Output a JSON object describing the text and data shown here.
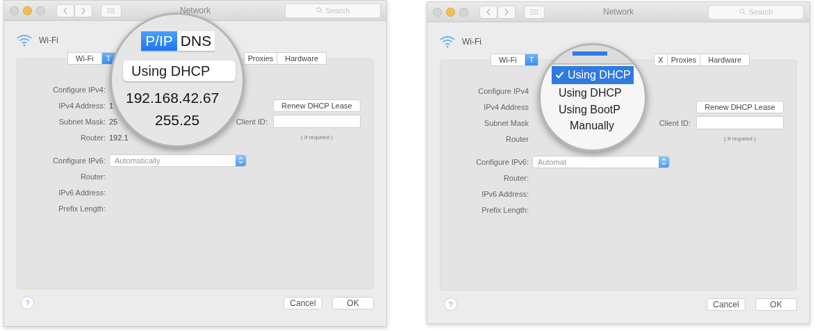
{
  "panels": [
    {
      "window": {
        "title": "Network",
        "search_placeholder": "Search"
      },
      "header": "Wi-Fi",
      "tabs": [
        {
          "label": "Wi-Fi",
          "selected": false
        },
        {
          "label": "T",
          "selected": true
        },
        {
          "label": "Proxies",
          "selected": false
        },
        {
          "label": "Hardware",
          "selected": false
        }
      ],
      "ipv4_rows": [
        {
          "label": "Configure IPv4:"
        },
        {
          "label": "IPv4 Address:",
          "value": "1"
        },
        {
          "label": "Subnet Mask:",
          "value": "25"
        },
        {
          "label": "Router:",
          "value": "192.1"
        }
      ],
      "renew_button": "Renew DHCP Lease",
      "client_id": {
        "label": "Client ID:",
        "hint": "( If required )"
      },
      "ipv6": {
        "label": "Configure IPv6:",
        "value": "Automatically"
      },
      "ipv6_rows": [
        "Router:",
        "IPv6 Address:",
        "Prefix Length:"
      ],
      "help": "?",
      "buttons": [
        "Cancel",
        "OK"
      ],
      "magnifier": {
        "kind": "field",
        "tabs": [
          {
            "label": "P/IP",
            "selected": true
          },
          {
            "label": "DNS",
            "selected": false
          }
        ],
        "field_value": "Using DHCP",
        "lines": [
          "192.168.42.67",
          "255.25"
        ]
      }
    },
    {
      "window": {
        "title": "Network",
        "search_placeholder": "Search"
      },
      "header": "Wi-Fi",
      "tabs": [
        {
          "label": "Wi-Fi",
          "selected": false
        },
        {
          "label": "T",
          "selected": true
        },
        {
          "label": "X",
          "selected": false
        },
        {
          "label": "Proxies",
          "selected": false
        },
        {
          "label": "Hardware",
          "selected": false
        }
      ],
      "ipv4_rows": [
        {
          "label": "Configure IPv4"
        },
        {
          "label": "IPv4 Address"
        },
        {
          "label": "Subnet Mask"
        },
        {
          "label": "Router"
        }
      ],
      "renew_button": "Renew DHCP Lease",
      "client_id": {
        "label": "Client ID:",
        "hint": "( If required )"
      },
      "ipv6": {
        "label": "Configure IPv6:",
        "value": "Automat"
      },
      "ipv6_rows": [
        "Router:",
        "IPv6 Address:",
        "Prefix Length:"
      ],
      "help": "?",
      "buttons": [
        "Cancel",
        "OK"
      ],
      "magnifier": {
        "kind": "menu",
        "menu_items": [
          {
            "label": "Using DHCP",
            "selected": true
          },
          {
            "label": "Using DHCP",
            "selected": false
          },
          {
            "label": "Using BootP",
            "selected": false
          },
          {
            "label": "Manually",
            "selected": false
          }
        ]
      }
    }
  ]
}
